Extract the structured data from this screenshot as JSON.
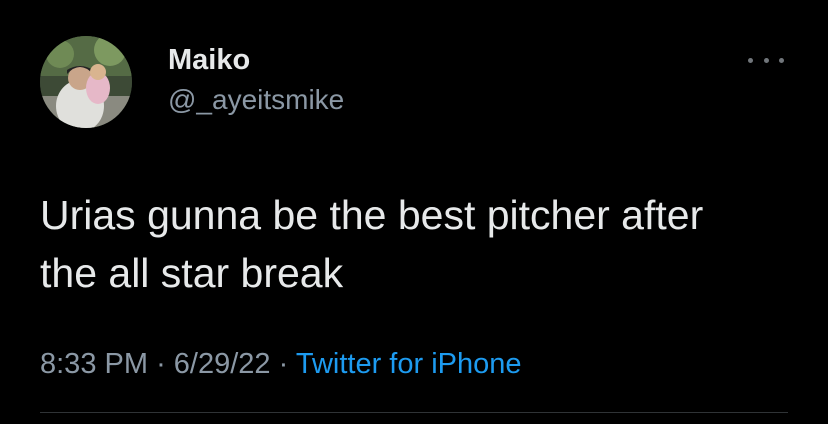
{
  "tweet": {
    "display_name": "Maiko",
    "handle": "@_ayeitsmike",
    "text_line_1": "Urias gunna be the best pitcher after",
    "text_line_2": "the all star break",
    "time": "8:33 PM",
    "date": "6/29/22",
    "separator": "·",
    "source": "Twitter for iPhone"
  },
  "icons": {
    "more": "more-horizontal-icon"
  },
  "colors": {
    "background": "#000000",
    "primary_text": "#e7e9ea",
    "secondary_text": "#8b98a5",
    "link": "#1d9bf0",
    "divider": "#2f3336"
  }
}
